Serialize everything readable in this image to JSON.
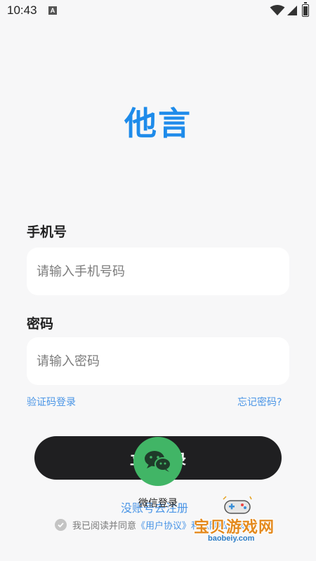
{
  "status_bar": {
    "time": "10:43",
    "notification_badge": "A"
  },
  "app": {
    "logo_text": "他言",
    "brand_color": "#1e8bea"
  },
  "form": {
    "phone": {
      "label": "手机号",
      "placeholder": "请输入手机号码",
      "value": ""
    },
    "password": {
      "label": "密码",
      "placeholder": "请输入密码",
      "value": ""
    }
  },
  "links": {
    "sms_login": "验证码登录",
    "forgot_password": "忘记密码?",
    "register": "没账号去注册"
  },
  "buttons": {
    "login": "立即登录",
    "wechat": {
      "label": "微信登录",
      "icon": "wechat-icon",
      "color": "#41b566"
    }
  },
  "agreement": {
    "prefix": "我已阅读并同意",
    "link_text": "《用户协议》和《隐私政策》",
    "checked": false
  },
  "watermark": {
    "title": "宝贝游戏网",
    "url": "baobeiy.com"
  }
}
